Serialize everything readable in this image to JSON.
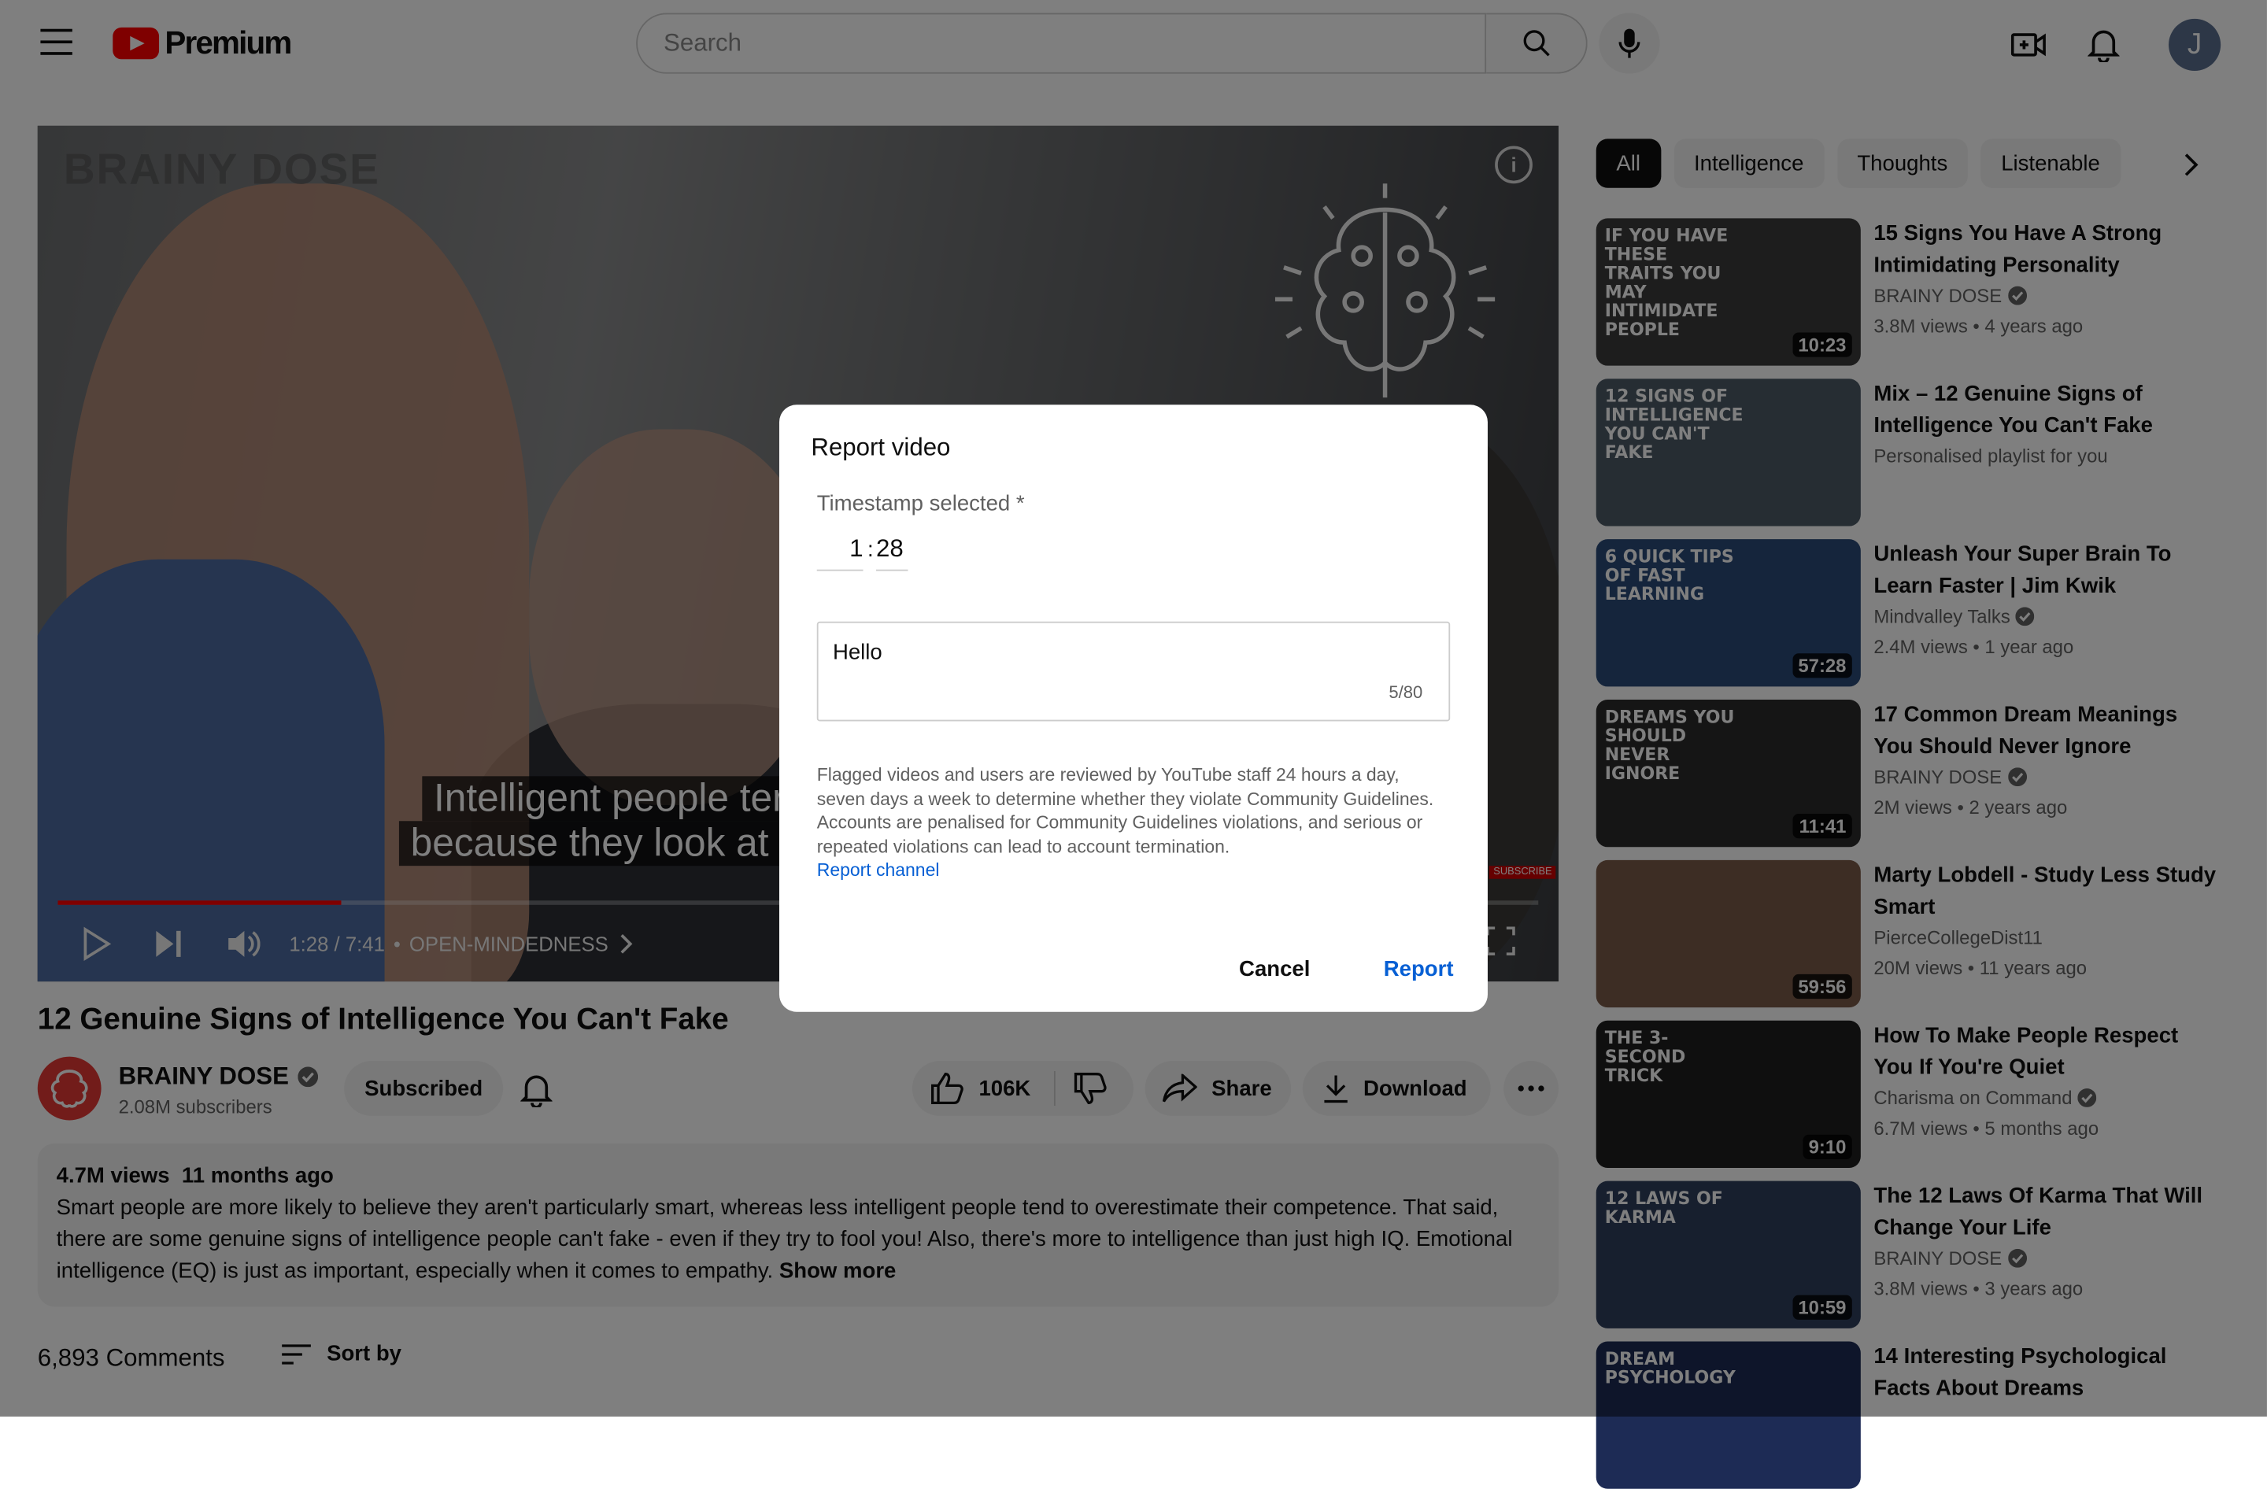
{
  "header": {
    "logo_text": "Premium",
    "search_placeholder": "Search",
    "avatar_letter": "J"
  },
  "player": {
    "watermark": "BRAINY DOSE",
    "caption_line1": "Intelligent people ter",
    "caption_line2": "because they look at a",
    "time": "1:28 / 7:41",
    "chapter": "OPEN-MINDEDNESS",
    "subscribe_tag": "SUBSCRIBE",
    "progress_fraction": 0.191
  },
  "video": {
    "title": "12 Genuine Signs of Intelligence You Can't Fake",
    "channel": "BRAINY DOSE",
    "subscribers": "2.08M subscribers",
    "subscribed_label": "Subscribed",
    "likes": "106K",
    "share_label": "Share",
    "download_label": "Download",
    "views": "4.7M views",
    "age": "11 months ago",
    "description": "Smart people are more likely to believe they aren't particularly smart, whereas less intelligent people tend to overestimate their competence. That said, there are some genuine signs of intelligence people can't fake - even if they try to fool you! Also, there's more to intelligence than just high IQ. Emotional intelligence (EQ) is just as important, especially when it comes to empathy.",
    "show_more": "Show more",
    "comments": "6,893 Comments",
    "sort_by": "Sort by"
  },
  "chips": [
    "All",
    "Intelligence",
    "Thoughts",
    "Listenable"
  ],
  "recommendations": [
    {
      "title": "15 Signs You Have A Strong Intimidating Personality",
      "channel": "BRAINY DOSE",
      "verified": true,
      "meta": "3.8M views  • 4 years ago",
      "duration": "10:23",
      "thumb_text": "IF YOU HAVE THESE TRAITS YOU MAY INTIMIDATE PEOPLE",
      "thumb_color": "#3a3a3a"
    },
    {
      "title": "Mix – 12 Genuine Signs of Intelligence You Can't Fake",
      "channel": "",
      "verified": false,
      "meta": "Personalised playlist for you",
      "duration": "",
      "thumb_text": "12 SIGNS OF INTELLIGENCE YOU CAN'T FAKE",
      "thumb_color": "#4c5a66"
    },
    {
      "title": "Unleash Your Super Brain To Learn Faster | Jim Kwik",
      "channel": "Mindvalley Talks",
      "verified": true,
      "meta": "2.4M views  • 1 year ago",
      "duration": "57:28",
      "thumb_text": "6 QUICK TIPS OF FAST LEARNING",
      "thumb_color": "#2a4a78"
    },
    {
      "title": "17 Common Dream Meanings You Should Never Ignore",
      "channel": "BRAINY DOSE",
      "verified": true,
      "meta": "2M views  • 2 years ago",
      "duration": "11:41",
      "thumb_text": "DREAMS YOU SHOULD NEVER IGNORE",
      "thumb_color": "#2b2b2b"
    },
    {
      "title": "Marty Lobdell - Study Less Study Smart",
      "channel": "PierceCollegeDist11",
      "verified": false,
      "meta": "20M views  • 11 years ago",
      "duration": "59:56",
      "thumb_text": "",
      "thumb_color": "#7a5a48"
    },
    {
      "title": "How To Make People Respect You If You're Quiet",
      "channel": "Charisma on Command",
      "verified": true,
      "meta": "6.7M views  • 5 months ago",
      "duration": "9:10",
      "thumb_text": "THE 3-SECOND TRICK",
      "thumb_color": "#1f1f1f"
    },
    {
      "title": "The 12 Laws Of Karma That Will Change Your Life",
      "channel": "BRAINY DOSE",
      "verified": true,
      "meta": "3.8M views  • 3 years ago",
      "duration": "10:59",
      "thumb_text": "12 LAWS OF KARMA",
      "thumb_color": "#2f3e5c"
    },
    {
      "title": "14 Interesting Psychological Facts About Dreams",
      "channel": "",
      "verified": false,
      "meta": "",
      "duration": "",
      "thumb_text": "DREAM PSYCHOLOGY",
      "thumb_color": "#1d2b55"
    }
  ],
  "dialog": {
    "title": "Report video",
    "timestamp_label": "Timestamp selected *",
    "ts_minutes": "1",
    "ts_seconds": "28",
    "ts_sep": ":",
    "text": "Hello",
    "count": "5/80",
    "body": "Flagged videos and users are reviewed by YouTube staff 24 hours a day, seven days a week to determine whether they violate Community Guidelines. Accounts are penalised for Community Guidelines violations, and serious or repeated violations can lead to account termination.",
    "link": "Report channel",
    "cancel": "Cancel",
    "report": "Report"
  },
  "colors": {
    "accent": "#065fd4",
    "brand_red": "#ff0000"
  }
}
